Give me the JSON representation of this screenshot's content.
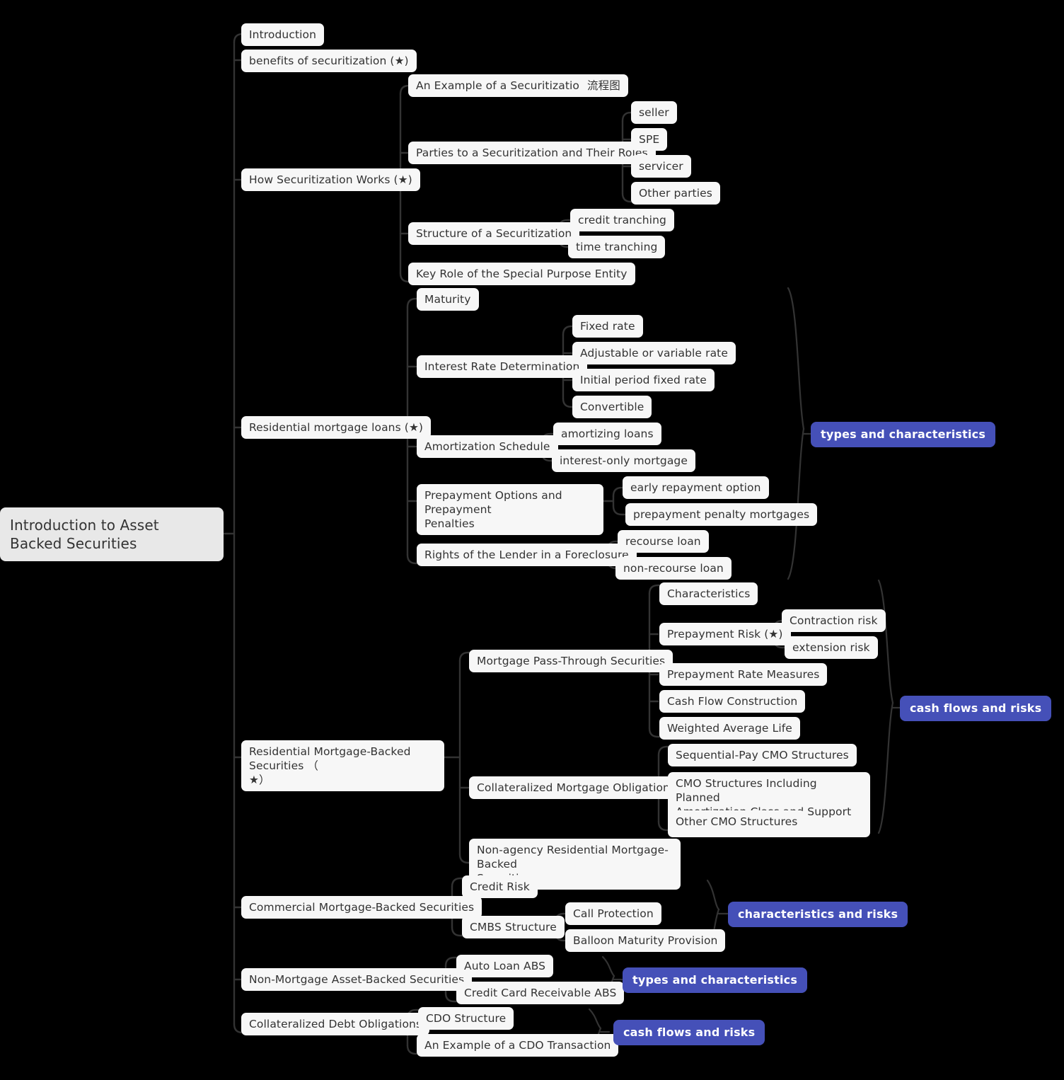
{
  "diagram": {
    "type": "mindmap",
    "background": "#000000",
    "node_bg": "#f7f7f7",
    "root_bg": "#e8e8e8",
    "badge_bg": "#4550b8",
    "edge_color": "#333333",
    "root": {
      "label": "Introduction to Asset Backed Securities"
    },
    "nodes": {
      "introduction": "Introduction",
      "benefits": "benefits of securitization (★)",
      "how_securitization_works": "How Securitization Works (★)",
      "an_example_of_a_securitization": "An Example of a Securitization",
      "flowchart": "流程图",
      "parties": "Parties to a Securitization and Their Roles",
      "seller": "seller",
      "spe": "SPE",
      "servicer": "servicer",
      "other_parties": "Other parties",
      "structure_of_securitization": "Structure of a Securitization",
      "credit_tranching": "credit tranching",
      "time_tranching": "time tranching",
      "key_role_spe": "Key Role of the Special Purpose Entity",
      "residential_mortgage_loans": "Residential mortgage loans (★)",
      "maturity": "Maturity",
      "interest_rate_determination": "Interest Rate Determination",
      "fixed_rate": "Fixed rate",
      "adjustable_rate": "Adjustable or variable rate",
      "initial_period_fixed_rate": "Initial period fixed rate",
      "convertible": "Convertible",
      "amortization_schedule": "Amortization Schedule",
      "amortizing_loans": "amortizing loans",
      "interest_only_mortgage": "interest-only mortgage",
      "prepayment_options": "Prepayment Options and Prepayment\nPenalties",
      "early_repayment_option": "early repayment option",
      "prepayment_penalty_mortgages": "prepayment penalty mortgages",
      "rights_of_lender": "Rights of the Lender in a Foreclosure",
      "recourse_loan": "recourse loan",
      "non_recourse_loan": "non-recourse loan",
      "badge_types_characteristics_1": "types and characteristics",
      "rmbs": "Residential Mortgage-Backed Securities （\n★）",
      "mortgage_pass_through": "Mortgage Pass-Through Securities",
      "characteristics": "Characteristics",
      "prepayment_risk": "Prepayment Risk (★)",
      "contraction_risk": "Contraction risk",
      "extension_risk": "extension risk",
      "prepayment_rate_measures": "Prepayment Rate Measures",
      "cash_flow_construction": "Cash Flow Construction",
      "weighted_average_life": "Weighted Average Life",
      "cmo": "Collateralized Mortgage Obligations",
      "sequential_pay_cmo": "Sequential-Pay CMO Structures",
      "cmo_pac": "CMO Structures Including Planned\nAmortization Class and Support Tranches",
      "other_cmo": "Other CMO Structures",
      "non_agency_rmbs": "Non-agency Residential Mortgage-Backed\nSecurities",
      "badge_cash_flows_risks_1": "cash flows and risks",
      "cmbs": "Commercial Mortgage-Backed Securities",
      "credit_risk": "Credit Risk",
      "cmbs_structure": "CMBS Structure",
      "call_protection": "Call Protection",
      "balloon_maturity_provision": "Balloon Maturity Provision",
      "badge_characteristics_risks": "characteristics and risks",
      "non_mortgage_abs": "Non-Mortgage Asset-Backed Securities",
      "auto_loan_abs": "Auto Loan ABS",
      "credit_card_abs": "Credit Card Receivable ABS",
      "badge_types_characteristics_2": "types and characteristics",
      "cdo": "Collateralized Debt Obligations",
      "cdo_structure": "CDO Structure",
      "cdo_example": "An Example of a CDO Transaction",
      "badge_cash_flows_risks_2": "cash flows and risks"
    }
  }
}
